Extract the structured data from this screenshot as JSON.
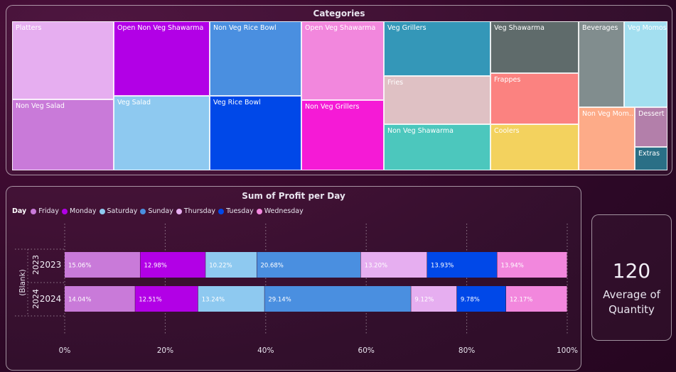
{
  "treemap": {
    "title": "Categories",
    "tiles": [
      {
        "label": "Platters",
        "color": "#e6aef0"
      },
      {
        "label": "Non Veg Salad",
        "color": "#c97ad9"
      },
      {
        "label": "Open Non Veg Shawarma",
        "color": "#b200e6"
      },
      {
        "label": "Veg Salad",
        "color": "#8ec9f0"
      },
      {
        "label": "Non Veg Rice Bowl",
        "color": "#4a8fe0"
      },
      {
        "label": "Veg Rice Bowl",
        "color": "#0048e8"
      },
      {
        "label": "Open Veg Shawarma",
        "color": "#f287dd"
      },
      {
        "label": "Non Veg Grillers",
        "color": "#f51ad6"
      },
      {
        "label": "Veg Grillers",
        "color": "#3497b8"
      },
      {
        "label": "Fries",
        "color": "#dfc1c4"
      },
      {
        "label": "Non Veg Shawarma",
        "color": "#4cc7bd"
      },
      {
        "label": "Veg Shawarma",
        "color": "#5f6b6b"
      },
      {
        "label": "Frappes",
        "color": "#fb8280"
      },
      {
        "label": "Coolers",
        "color": "#f3d25e"
      },
      {
        "label": "Beverages",
        "color": "#818d8e"
      },
      {
        "label": "Non Veg Mom...",
        "color": "#fdab88"
      },
      {
        "label": "Veg Momos",
        "color": "#a3dff0"
      },
      {
        "label": "Dessert",
        "color": "#b37faa"
      },
      {
        "label": "Extras",
        "color": "#2a6f86"
      }
    ]
  },
  "bar_chart": {
    "title": "Sum of Profit per Day",
    "legend_title": "Day",
    "legend": [
      {
        "name": "Friday",
        "color": "#c97ad9"
      },
      {
        "name": "Monday",
        "color": "#b200e6"
      },
      {
        "name": "Saturday",
        "color": "#8ec9f0"
      },
      {
        "name": "Sunday",
        "color": "#4a8fe0"
      },
      {
        "name": "Thursday",
        "color": "#e6aef0"
      },
      {
        "name": "Tuesday",
        "color": "#0048e8"
      },
      {
        "name": "Wednesday",
        "color": "#f287dd"
      }
    ]
  },
  "chart_data": {
    "type": "bar",
    "orientation": "horizontal",
    "stacked": "100%",
    "title": "Sum of Profit per Day",
    "group_label": "(Blank)",
    "categories": [
      "2023",
      "2024"
    ],
    "series": [
      {
        "name": "Friday",
        "values": [
          15.06,
          14.04
        ]
      },
      {
        "name": "Monday",
        "values": [
          12.98,
          12.51
        ]
      },
      {
        "name": "Saturday",
        "values": [
          10.22,
          13.24
        ]
      },
      {
        "name": "Sunday",
        "values": [
          20.68,
          29.14
        ]
      },
      {
        "name": "Thursday",
        "values": [
          13.2,
          9.12
        ]
      },
      {
        "name": "Tuesday",
        "values": [
          13.93,
          9.78
        ]
      },
      {
        "name": "Wednesday",
        "values": [
          13.94,
          12.17
        ]
      }
    ],
    "data_labels": [
      [
        "15.06%",
        "12.98%",
        "10.22%",
        "20.68%",
        "13.20%",
        "13.93%",
        "13.94%"
      ],
      [
        "14.04%",
        "12.51%",
        "13.24%",
        "29.14%",
        "9.12%",
        "9.78%",
        "12.17%"
      ]
    ],
    "xlim": [
      0,
      100
    ],
    "xticks": [
      "0%",
      "20%",
      "40%",
      "60%",
      "80%",
      "100%"
    ],
    "grid": true,
    "legend_position": "top-left"
  },
  "kpi": {
    "value": "120",
    "label_line1": "Average of",
    "label_line2": "Quantity"
  }
}
